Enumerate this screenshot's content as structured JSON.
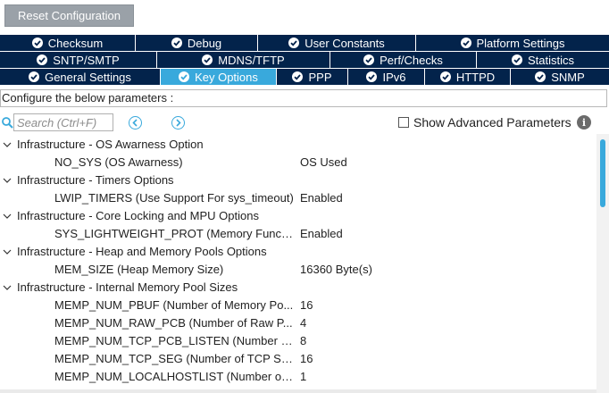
{
  "reset_button": "Reset Configuration",
  "tab_rows": [
    [
      {
        "label": "Checksum",
        "active": false
      },
      {
        "label": "Debug",
        "active": false
      },
      {
        "label": "User Constants",
        "active": false
      },
      {
        "label": "Platform Settings",
        "active": false
      }
    ],
    [
      {
        "label": "SNTP/SMTP",
        "active": false
      },
      {
        "label": "MDNS/TFTP",
        "active": false
      },
      {
        "label": "Perf/Checks",
        "active": false
      },
      {
        "label": "Statistics",
        "active": false
      }
    ],
    [
      {
        "label": "General Settings",
        "active": false
      },
      {
        "label": "Key Options",
        "active": true
      },
      {
        "label": "PPP",
        "active": false
      },
      {
        "label": "IPv6",
        "active": false
      },
      {
        "label": "HTTPD",
        "active": false
      },
      {
        "label": "SNMP",
        "active": false
      }
    ]
  ],
  "config_label": "Configure the below parameters :",
  "search": {
    "placeholder": "Search (Ctrl+F)",
    "value": ""
  },
  "show_advanced": {
    "label": "Show Advanced Parameters",
    "checked": false
  },
  "tree": [
    {
      "type": "group",
      "label": "Infrastructure - OS Awarness Option"
    },
    {
      "type": "param",
      "name": "NO_SYS (OS Awarness)",
      "value": "OS Used"
    },
    {
      "type": "group",
      "label": "Infrastructure - Timers Options"
    },
    {
      "type": "param",
      "name": "LWIP_TIMERS (Use Support For sys_timeout)",
      "value": "Enabled"
    },
    {
      "type": "group",
      "label": "Infrastructure - Core Locking and MPU Options"
    },
    {
      "type": "param",
      "name": "SYS_LIGHTWEIGHT_PROT (Memory Functi...",
      "value": "Enabled"
    },
    {
      "type": "group",
      "label": "Infrastructure - Heap and Memory Pools Options"
    },
    {
      "type": "param",
      "name": "MEM_SIZE (Heap Memory Size)",
      "value": "16360 Byte(s)"
    },
    {
      "type": "group",
      "label": "Infrastructure - Internal Memory Pool Sizes"
    },
    {
      "type": "param",
      "name": "MEMP_NUM_PBUF (Number of Memory Po...",
      "value": "16"
    },
    {
      "type": "param",
      "name": "MEMP_NUM_RAW_PCB (Number of Raw P...",
      "value": "4"
    },
    {
      "type": "param",
      "name": "MEMP_NUM_TCP_PCB_LISTEN (Number of...",
      "value": "8"
    },
    {
      "type": "param",
      "name": "MEMP_NUM_TCP_SEG (Number of TCP Se...",
      "value": "16"
    },
    {
      "type": "param",
      "name": "MEMP_NUM_LOCALHOSTLIST (Number of ...",
      "value": "1"
    }
  ],
  "colors": {
    "tab_bg": "#03234b",
    "tab_active": "#39a9dc",
    "accent": "#39a9dc"
  }
}
